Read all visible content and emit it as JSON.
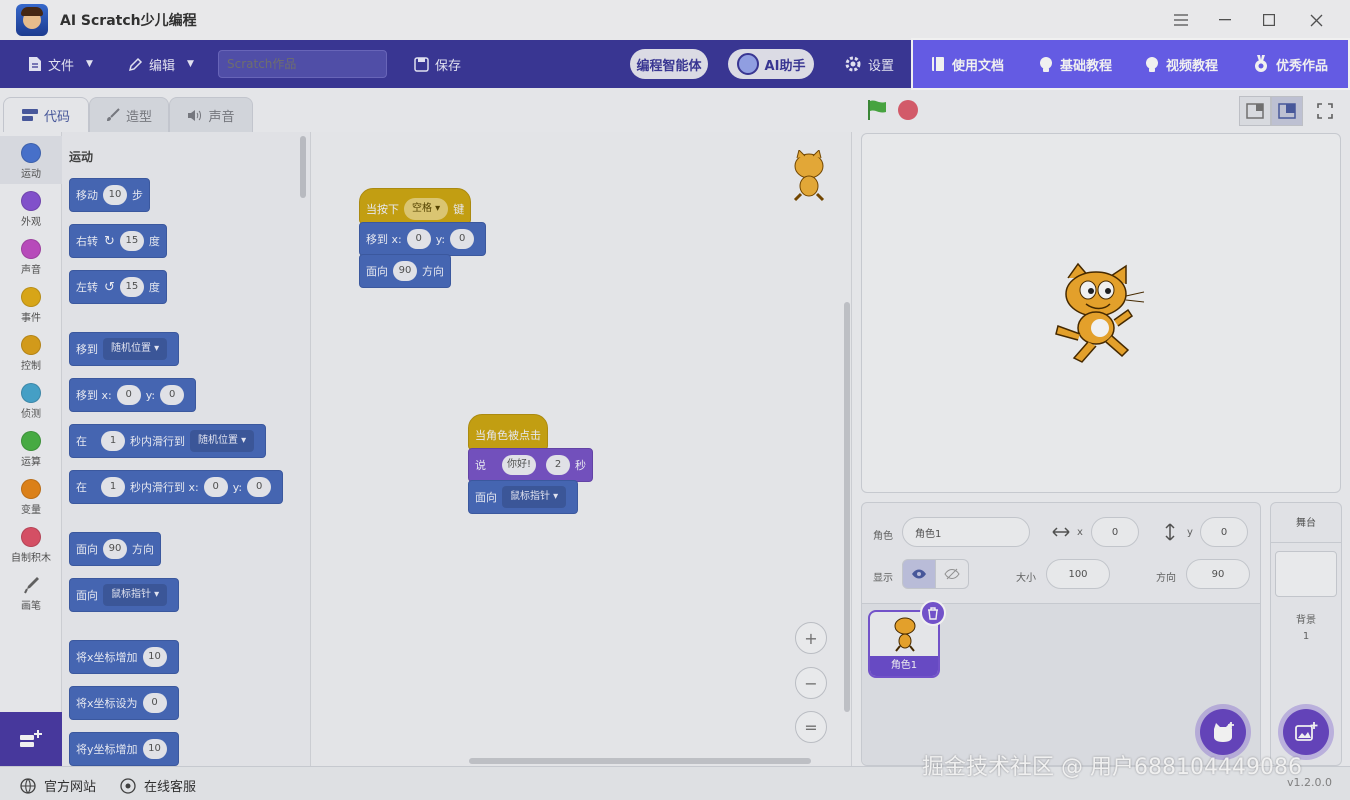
{
  "window": {
    "title": "AI Scratch少儿编程",
    "controls": [
      "menu",
      "minimize",
      "maximize",
      "close"
    ]
  },
  "menubar": {
    "file": "文件",
    "edit": "编辑",
    "project_placeholder": "Scratch作品",
    "save": "保存",
    "agent": "编程智能体",
    "ai_helper": "AI助手",
    "settings": "设置",
    "highlight_items": [
      {
        "label": "使用文档",
        "icon": "book-icon"
      },
      {
        "label": "基础教程",
        "icon": "bulb-icon"
      },
      {
        "label": "视频教程",
        "icon": "bulb-icon"
      },
      {
        "label": "优秀作品",
        "icon": "medal-icon"
      }
    ]
  },
  "tabs": [
    {
      "label": "代码",
      "active": true
    },
    {
      "label": "造型",
      "active": false
    },
    {
      "label": "声音",
      "active": false
    }
  ],
  "categories": [
    {
      "label": "运动",
      "color": "#4c78d6"
    },
    {
      "label": "外观",
      "color": "#8a55d7"
    },
    {
      "label": "声音",
      "color": "#c34fc6"
    },
    {
      "label": "事件",
      "color": "#e5b01a"
    },
    {
      "label": "控制",
      "color": "#e0a41c"
    },
    {
      "label": "侦测",
      "color": "#4aa9d2"
    },
    {
      "label": "运算",
      "color": "#4cb548"
    },
    {
      "label": "变量",
      "color": "#e9881a"
    },
    {
      "label": "自制积木",
      "color": "#e2546b"
    },
    {
      "label": "画笔",
      "color": "#3e8a64"
    }
  ],
  "palette": {
    "section": "运动",
    "blocks": {
      "move": {
        "a": "移动",
        "n": "10",
        "b": "步"
      },
      "turn_right": {
        "a": "右转",
        "n": "15",
        "b": "度"
      },
      "turn_left": {
        "a": "左转",
        "n": "15",
        "b": "度"
      },
      "goto": {
        "a": "移到",
        "d": "随机位置"
      },
      "goto_xy": {
        "a": "移到 x:",
        "x": "0",
        "yl": "y:",
        "y": "0"
      },
      "glide": {
        "a": "在",
        "n": "1",
        "b": "秒内滑行到",
        "d": "随机位置"
      },
      "glide_xy": {
        "a": "在",
        "n": "1",
        "b": "秒内滑行到 x:",
        "x": "0",
        "yl": "y:",
        "y": "0"
      },
      "point": {
        "a": "面向",
        "n": "90",
        "b": "方向"
      },
      "point_towards": {
        "a": "面向",
        "d": "鼠标指针"
      },
      "change_x": {
        "a": "将x坐标增加",
        "n": "10"
      },
      "set_x": {
        "a": "将x坐标设为",
        "n": "0"
      },
      "change_y": {
        "a": "将y坐标增加",
        "n": "10"
      }
    }
  },
  "scripts": {
    "s1": {
      "hat": {
        "a": "当按下",
        "d": "空格",
        "b": "键"
      },
      "goto_xy": {
        "a": "移到 x:",
        "x": "0",
        "yl": "y:",
        "y": "0"
      },
      "point": {
        "a": "面向",
        "n": "90",
        "b": "方向"
      }
    },
    "s2": {
      "hat": {
        "a": "当角色被点击"
      },
      "say": {
        "a": "说",
        "t": "你好!",
        "n": "2",
        "b": "秒"
      },
      "point_towards": {
        "a": "面向",
        "d": "鼠标指针"
      }
    }
  },
  "zoom": {
    "in": "+",
    "out": "−",
    "reset": "="
  },
  "sprite_info": {
    "sprite_label": "角色",
    "sprite_name": "角色1",
    "x_label": "x",
    "x_value": "0",
    "y_label": "y",
    "y_value": "0",
    "show_label": "显示",
    "size_label": "大小",
    "size_value": "100",
    "direction_label": "方向",
    "direction_value": "90"
  },
  "sprites": [
    {
      "name": "角色1",
      "selected": true
    }
  ],
  "stage_panel": {
    "title": "舞台",
    "backdrop_label": "背景",
    "backdrop_count": "1"
  },
  "status": {
    "website": "官方网站",
    "support": "在线客服",
    "version": "v1.2.0.0"
  },
  "watermark": "掘金技术社区 @ 用户688104449086",
  "colors": {
    "menubar": "#3d3a9c",
    "highlight": "#6b61f2",
    "motion": "#4a6cbd",
    "looks": "#7a55c8",
    "event": "#cfa814",
    "accent": "#7a58d6"
  }
}
